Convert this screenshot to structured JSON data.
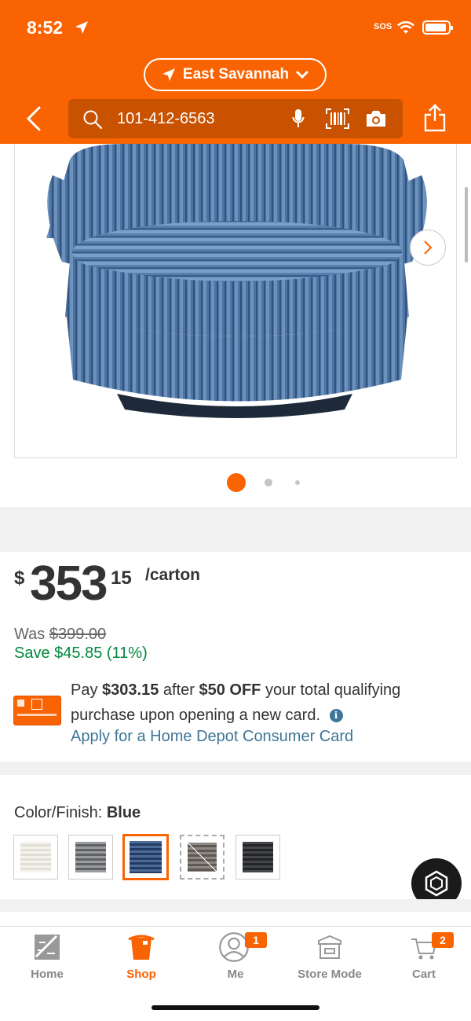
{
  "status_bar": {
    "time": "8:52",
    "sos": "SOS"
  },
  "header": {
    "store_name": "East Savannah",
    "search_value": "101-412-6563"
  },
  "gallery": {
    "dots_total": 3,
    "active_dot": 1
  },
  "price": {
    "currency": "$",
    "dollars": "353",
    "cents": "15",
    "unit": "/carton",
    "was_label": "Was",
    "was_price": "$399.00",
    "save_text": "Save $45.85 (11%)"
  },
  "card_offer": {
    "pay_prefix": "Pay",
    "pay_amount": "$303.15",
    "pay_after": "after",
    "off_amount": "$50 OFF",
    "pay_rest": "your total qualifying purchase upon opening a new card.",
    "info_glyph": "i",
    "apply_link": "Apply for a Home Depot Consumer Card"
  },
  "color": {
    "label": "Color/Finish:",
    "selected": "Blue",
    "swatches": [
      {
        "name": "cream",
        "color": "#e6e4dc",
        "stripe": "#f4f3ee"
      },
      {
        "name": "gray",
        "color": "#6d6f73",
        "stripe": "#9a9ca0"
      },
      {
        "name": "blue",
        "color": "#2f4a75",
        "stripe": "#4c6b99",
        "selected": true
      },
      {
        "name": "taupe",
        "color": "#6e6864",
        "stripe": "#8e8883",
        "unavailable": true
      },
      {
        "name": "black",
        "color": "#2c2d30",
        "stripe": "#45464a"
      }
    ]
  },
  "nav": {
    "items": [
      {
        "label": "Home"
      },
      {
        "label": "Shop"
      },
      {
        "label": "Me",
        "badge": "1"
      },
      {
        "label": "Store Mode"
      },
      {
        "label": "Cart",
        "badge": "2"
      }
    ]
  },
  "colors": {
    "brand": "#f96302",
    "save_green": "#00873c",
    "link_blue": "#3e7697"
  }
}
